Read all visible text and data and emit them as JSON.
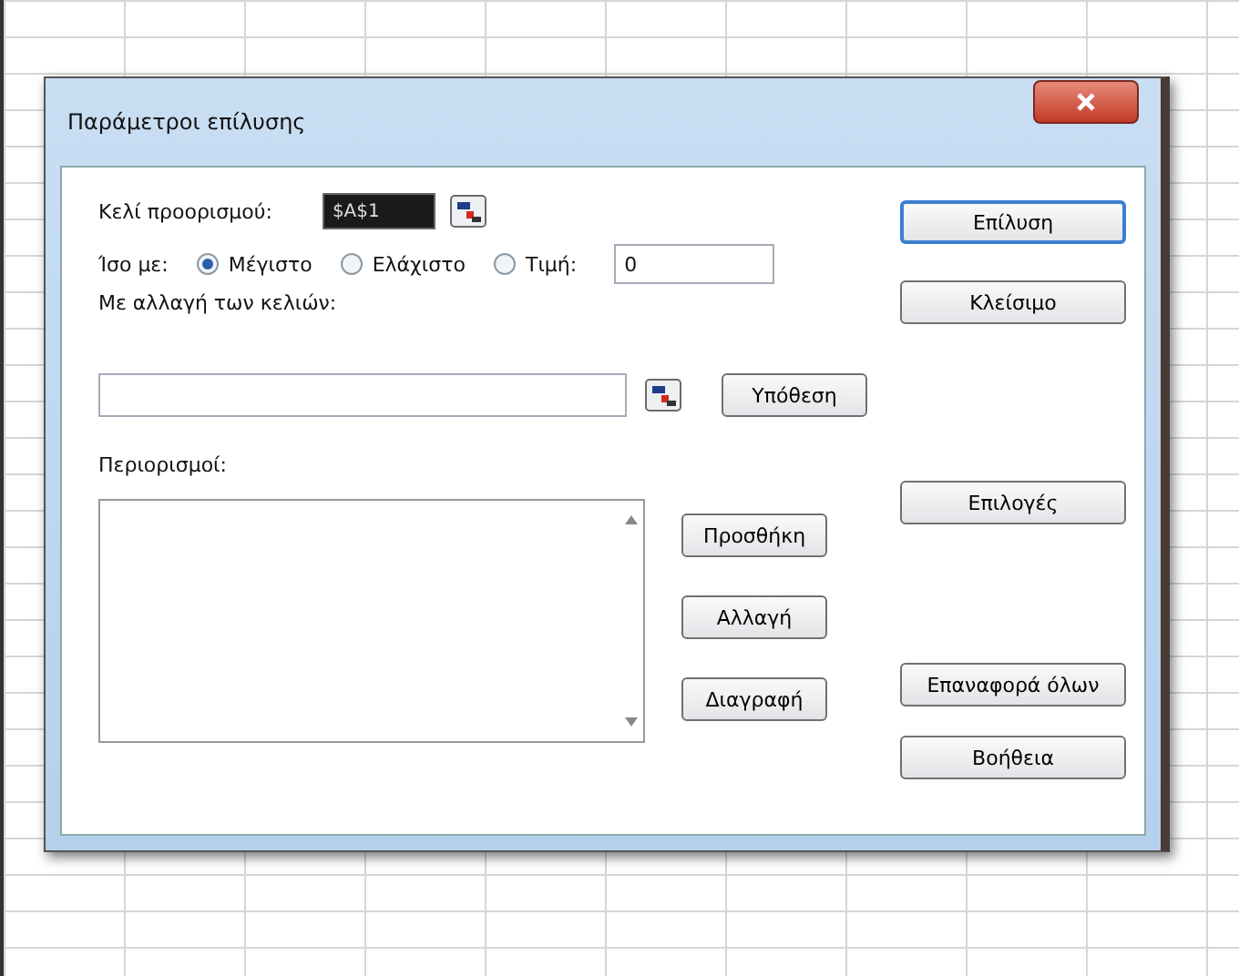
{
  "window": {
    "title": "Παράμετροι επίλυσης"
  },
  "target": {
    "label": "Κελί προορισμού:",
    "value": "$A$1"
  },
  "equal_to": {
    "label": "Ίσο με:",
    "options": [
      {
        "label": "Μέγιστο",
        "selected": true
      },
      {
        "label": "Ελάχιστο",
        "selected": false
      },
      {
        "label": "Τιμή:",
        "selected": false
      }
    ],
    "value": "0"
  },
  "changing_cells": {
    "label": "Με αλλαγή των κελιών:",
    "button": "Υπόθεση"
  },
  "constraints": {
    "label": "Περιορισμοί:",
    "buttons": [
      "Προσθήκη",
      "Αλλαγή",
      "Διαγραφή"
    ]
  },
  "buttons": [
    {
      "label": "Επίλυση",
      "default": true
    },
    {
      "label": "Κλείσιμο",
      "default": false
    },
    {
      "label": "Επιλογές",
      "default": false
    },
    {
      "label": "Επαναφορά όλων",
      "default": false
    },
    {
      "label": "Βοήθεια",
      "default": false
    }
  ]
}
